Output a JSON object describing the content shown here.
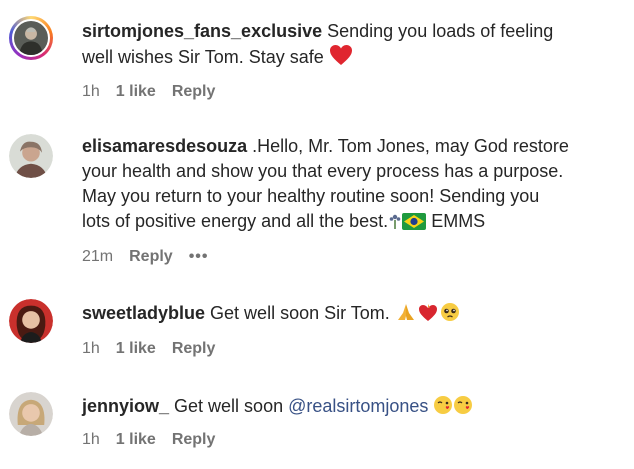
{
  "comments": [
    {
      "username": "sirtomjones_fans_exclusive",
      "text_line1": " Sending you loads of feeling",
      "text_line2": "well wishes Sir Tom. Stay safe ",
      "time": "1h",
      "likes": "1 like",
      "reply": "Reply",
      "emoji": "red-heart"
    },
    {
      "username": "elisamaresdesouza",
      "text_line1": " .Hello, Mr. Tom Jones, may God restore",
      "text_line2": "your health and show you that every process has a purpose.",
      "text_line3": "May you return to your healthy routine soon! Sending you",
      "text_line4": "lots of positive energy and all the best.",
      "text_tail": " EMMS",
      "time": "21m",
      "reply": "Reply",
      "more": "•••"
    },
    {
      "username": "sweetladyblue",
      "text_line1": " Get well soon Sir Tom. ",
      "time": "1h",
      "likes": "1 like",
      "reply": "Reply"
    },
    {
      "username": "jennyiow_",
      "text_line1": " Get well soon ",
      "mention": "@realsirtomjones",
      "time": "1h",
      "likes": "1 like",
      "reply": "Reply"
    }
  ]
}
